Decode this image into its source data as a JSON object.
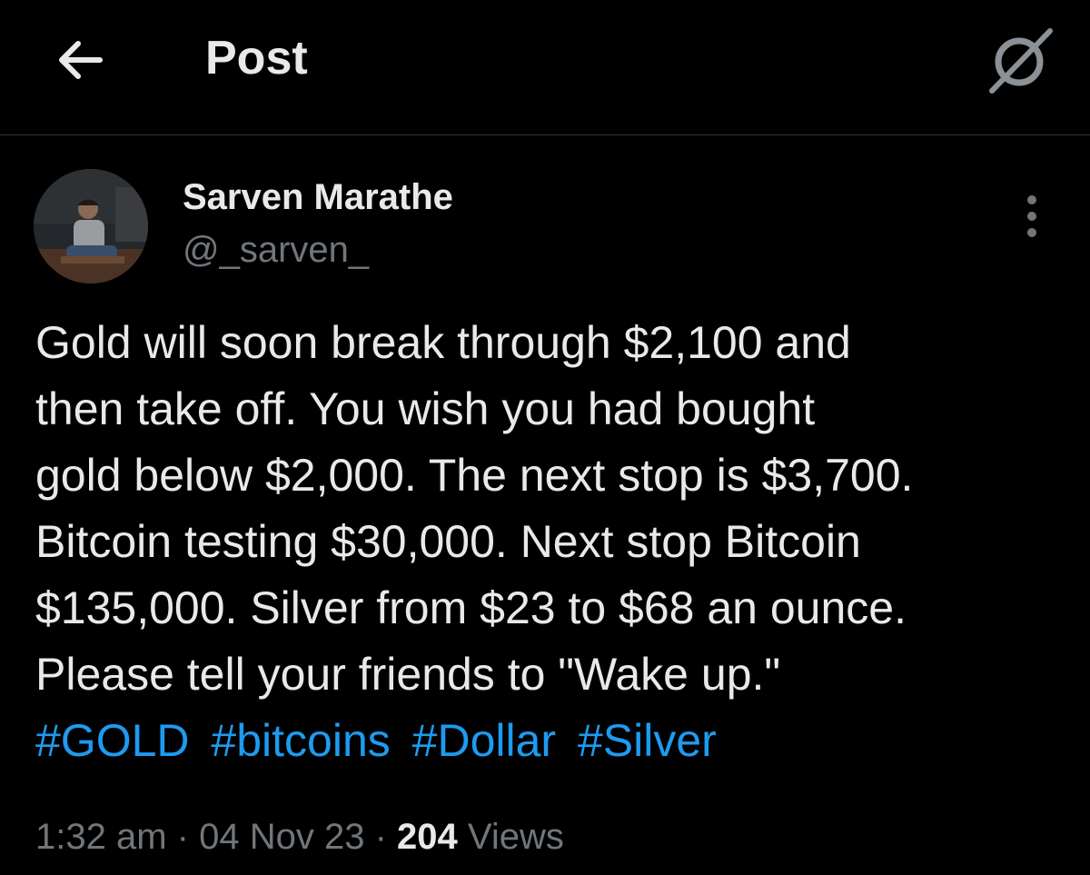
{
  "header": {
    "title": "Post",
    "back_icon": "arrow-left-icon",
    "grok_icon": "grok-icon"
  },
  "author": {
    "name": "Sarven Marathe",
    "handle": "@_sarven_",
    "more_icon": "more-vertical-icon"
  },
  "post": {
    "lines": [
      "Gold will soon break through $2,100 and",
      "then take off. You wish you had bought",
      "gold below $2,000. The next stop is $3,700.",
      "Bitcoin testing $30,000. Next stop Bitcoin",
      "$135,000. Silver from $23 to $68 an ounce.",
      "Please tell your friends to \"Wake up.\""
    ],
    "hashtags": [
      "#GOLD",
      "#bitcoins",
      "#Dollar",
      "#Silver"
    ]
  },
  "meta": {
    "time": "1:32 am",
    "separator": "·",
    "date": "04 Nov 23",
    "views_count": "204",
    "views_label": "Views"
  },
  "colors": {
    "background": "#000000",
    "text_primary": "#e7e9ea",
    "text_secondary": "#71767b",
    "link": "#1d9bf0",
    "divider": "#2f3336"
  }
}
